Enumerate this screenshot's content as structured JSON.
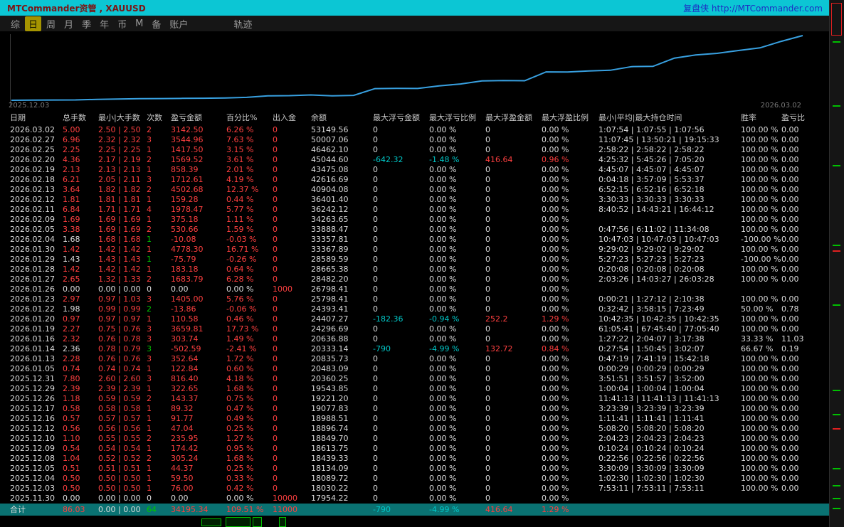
{
  "title_bar": {
    "app_title": "MTCommander资管 , XAUUSD",
    "brand": "复盘侠 http://MTCommander.com"
  },
  "menu": {
    "items": [
      "综",
      "日",
      "周",
      "月",
      "季",
      "年",
      "币",
      "M",
      "备",
      "账户"
    ],
    "selected_index": 1,
    "extra_item": "轨迹"
  },
  "chart": {
    "x_start_label": "2025.12.03",
    "x_end_label": "2026.03.02",
    "line_color": "#38a0e0"
  },
  "chart_data": {
    "type": "line",
    "title": "",
    "xlabel": "",
    "ylabel": "余额",
    "ylim": [
      17900,
      53200
    ],
    "grid": false,
    "legend": false,
    "x": [
      "2025.11.30",
      "2025.12.03",
      "2025.12.04",
      "2025.12.05",
      "2025.12.08",
      "2025.12.09",
      "2025.12.10",
      "2025.12.12",
      "2025.12.16",
      "2025.12.17",
      "2025.12.26",
      "2025.12.29",
      "2025.12.31",
      "2026.01.05",
      "2026.01.13",
      "2026.01.14",
      "2026.01.16",
      "2026.01.19",
      "2026.01.20",
      "2026.01.22",
      "2026.01.23",
      "2026.01.26",
      "2026.01.27",
      "2026.01.28",
      "2026.01.29",
      "2026.01.30",
      "2026.02.04",
      "2026.02.05",
      "2026.02.09",
      "2026.02.11",
      "2026.02.12",
      "2026.02.13",
      "2026.02.18",
      "2026.02.19",
      "2026.02.20",
      "2026.02.25",
      "2026.02.27",
      "2026.03.02"
    ],
    "series": [
      {
        "name": "余额",
        "values": [
          17954.22,
          18030.22,
          18089.72,
          18134.09,
          18439.33,
          18613.75,
          18849.7,
          18896.74,
          18988.51,
          19077.83,
          19221.2,
          19543.85,
          20360.25,
          20483.09,
          20835.73,
          20333.14,
          20636.88,
          24296.69,
          24407.27,
          24393.41,
          25798.41,
          26798.41,
          28482.2,
          28665.38,
          28589.59,
          33367.89,
          33357.81,
          33888.47,
          34263.65,
          36242.12,
          36401.4,
          40904.08,
          42616.69,
          43475.08,
          45044.6,
          46462.1,
          50007.06,
          53149.56
        ]
      }
    ]
  },
  "table": {
    "headers": [
      "日期",
      "总手数",
      "最小|大手数",
      "次数",
      "盈亏金额",
      "百分比%",
      "出入金",
      "余额",
      "最大浮亏金额",
      "最大浮亏比例",
      "最大浮盈金额",
      "最大浮盈比例",
      "最小|平均|最大持仓时间",
      "胜率",
      "盈亏比"
    ],
    "rows": [
      {
        "cells": [
          "2026.03.02",
          "5.00",
          "2.50 | 2.50",
          "2",
          "3142.50",
          "6.26 %",
          "0",
          "53149.56",
          "0",
          "0.00 %",
          "0",
          "0.00 %",
          "1:07:54 | 1:07:55 | 1:07:56",
          "100.00 %",
          "0.00"
        ]
      },
      {
        "cells": [
          "2026.02.27",
          "6.96",
          "2.32 | 2.32",
          "3",
          "3544.96",
          "7.63 %",
          "0",
          "50007.06",
          "0",
          "0.00 %",
          "0",
          "0.00 %",
          "11:07:45 | 13:50:21 | 19:15:33",
          "100.00 %",
          "0.00"
        ]
      },
      {
        "cells": [
          "2026.02.25",
          "2.25",
          "2.25 | 2.25",
          "1",
          "1417.50",
          "3.15 %",
          "0",
          "46462.10",
          "0",
          "0.00 %",
          "0",
          "0.00 %",
          "2:58:22 | 2:58:22 | 2:58:22",
          "100.00 %",
          "0.00"
        ]
      },
      {
        "cells": [
          "2026.02.20",
          "4.36",
          "2.17 | 2.19",
          "2",
          "1569.52",
          "3.61 %",
          "0",
          "45044.60",
          "-642.32",
          "-1.48 %",
          "416.64",
          "0.96 %",
          "4:25:32 | 5:45:26 | 7:05:20",
          "100.00 %",
          "0.00"
        ]
      },
      {
        "cells": [
          "2026.02.19",
          "2.13",
          "2.13 | 2.13",
          "1",
          "858.39",
          "2.01 %",
          "0",
          "43475.08",
          "0",
          "0.00 %",
          "0",
          "0.00 %",
          "4:45:07 | 4:45:07 | 4:45:07",
          "100.00 %",
          "0.00"
        ]
      },
      {
        "cells": [
          "2026.02.18",
          "6.21",
          "2.05 | 2.11",
          "3",
          "1712.61",
          "4.19 %",
          "0",
          "42616.69",
          "0",
          "0.00 %",
          "0",
          "0.00 %",
          "0:04:18 | 3:57:09 | 5:53:37",
          "100.00 %",
          "0.00"
        ]
      },
      {
        "cells": [
          "2026.02.13",
          "3.64",
          "1.82 | 1.82",
          "2",
          "4502.68",
          "12.37 %",
          "0",
          "40904.08",
          "0",
          "0.00 %",
          "0",
          "0.00 %",
          "6:52:15 | 6:52:16 | 6:52:18",
          "100.00 %",
          "0.00"
        ]
      },
      {
        "cells": [
          "2026.02.12",
          "1.81",
          "1.81 | 1.81",
          "1",
          "159.28",
          "0.44 %",
          "0",
          "36401.40",
          "0",
          "0.00 %",
          "0",
          "0.00 %",
          "3:30:33 | 3:30:33 | 3:30:33",
          "100.00 %",
          "0.00"
        ]
      },
      {
        "cells": [
          "2026.02.11",
          "6.84",
          "1.71 | 1.71",
          "4",
          "1978.47",
          "5.77 %",
          "0",
          "36242.12",
          "0",
          "0.00 %",
          "0",
          "0.00 %",
          "8:40:52 | 14:43:21 | 16:44:12",
          "100.00 %",
          "0.00"
        ]
      },
      {
        "cells": [
          "2026.02.09",
          "1.69",
          "1.69 | 1.69",
          "1",
          "375.18",
          "1.11 %",
          "0",
          "34263.65",
          "0",
          "0.00 %",
          "0",
          "0.00 %",
          "",
          "100.00 %",
          "0.00"
        ]
      },
      {
        "cells": [
          "2026.02.05",
          "3.38",
          "1.69 | 1.69",
          "2",
          "530.66",
          "1.59 %",
          "0",
          "33888.47",
          "0",
          "0.00 %",
          "0",
          "0.00 %",
          "0:47:56 | 6:11:02 | 11:34:08",
          "100.00 %",
          "0.00"
        ]
      },
      {
        "cells": [
          "2026.02.04",
          "1.68",
          "1.68 | 1.68",
          "1",
          "-10.08",
          "-0.03 %",
          "0",
          "33357.81",
          "0",
          "0.00 %",
          "0",
          "0.00 %",
          "10:47:03 | 10:47:03 | 10:47:03",
          "-100.00 %",
          "0.00"
        ],
        "loss": true
      },
      {
        "cells": [
          "2026.01.30",
          "1.42",
          "1.42 | 1.42",
          "1",
          "4778.30",
          "16.71 %",
          "0",
          "33367.89",
          "0",
          "0.00 %",
          "0",
          "0.00 %",
          "9:29:02 | 9:29:02 | 9:29:02",
          "100.00 %",
          "0.00"
        ]
      },
      {
        "cells": [
          "2026.01.29",
          "1.43",
          "1.43 | 1.43",
          "1",
          "-75.79",
          "-0.26 %",
          "0",
          "28589.59",
          "0",
          "0.00 %",
          "0",
          "0.00 %",
          "5:27:23 | 5:27:23 | 5:27:23",
          "-100.00 %",
          "0.00"
        ],
        "loss": true
      },
      {
        "cells": [
          "2026.01.28",
          "1.42",
          "1.42 | 1.42",
          "1",
          "183.18",
          "0.64 %",
          "0",
          "28665.38",
          "0",
          "0.00 %",
          "0",
          "0.00 %",
          "0:20:08 | 0:20:08 | 0:20:08",
          "100.00 %",
          "0.00"
        ]
      },
      {
        "cells": [
          "2026.01.27",
          "2.65",
          "1.32 | 1.33",
          "2",
          "1683.79",
          "6.28 %",
          "0",
          "28482.20",
          "0",
          "0.00 %",
          "0",
          "0.00 %",
          "2:03:26 | 14:03:27 | 26:03:28",
          "100.00 %",
          "0.00"
        ]
      },
      {
        "cells": [
          "2026.01.26",
          "0.00",
          "0.00 | 0.00",
          "0",
          "0.00",
          "0.00 %",
          "1000",
          "26798.41",
          "0",
          "0.00 %",
          "0",
          "0.00 %",
          "",
          "",
          ""
        ],
        "flat": true
      },
      {
        "cells": [
          "2026.01.23",
          "2.97",
          "0.97 | 1.03",
          "3",
          "1405.00",
          "5.76 %",
          "0",
          "25798.41",
          "0",
          "0.00 %",
          "0",
          "0.00 %",
          "0:00:21 | 1:27:12 | 2:10:38",
          "100.00 %",
          "0.00"
        ]
      },
      {
        "cells": [
          "2026.01.22",
          "1.98",
          "0.99 | 0.99",
          "2",
          "-13.86",
          "-0.06 %",
          "0",
          "24393.41",
          "0",
          "0.00 %",
          "0",
          "0.00 %",
          "0:32:42 | 3:58:15 | 7:23:49",
          "50.00 %",
          "0.78"
        ],
        "loss": true
      },
      {
        "cells": [
          "2026.01.20",
          "0.97",
          "0.97 | 0.97",
          "1",
          "110.58",
          "0.46 %",
          "0",
          "24407.27",
          "-182.36",
          "-0.94 %",
          "252.2",
          "1.29 %",
          "10:42:35 | 10:42:35 | 10:42:35",
          "100.00 %",
          "0.00"
        ]
      },
      {
        "cells": [
          "2026.01.19",
          "2.27",
          "0.75 | 0.76",
          "3",
          "3659.81",
          "17.73 %",
          "0",
          "24296.69",
          "0",
          "0.00 %",
          "0",
          "0.00 %",
          "61:05:41 | 67:45:40 | 77:05:40",
          "100.00 %",
          "0.00"
        ]
      },
      {
        "cells": [
          "2026.01.16",
          "2.32",
          "0.76 | 0.78",
          "3",
          "303.74",
          "1.49 %",
          "0",
          "20636.88",
          "0",
          "0.00 %",
          "0",
          "0.00 %",
          "1:27:22 | 2:04:07 | 3:17:38",
          "33.33 %",
          "11.03"
        ]
      },
      {
        "cells": [
          "2026.01.14",
          "2.36",
          "0.78 | 0.79",
          "3",
          "-502.59",
          "-2.41 %",
          "0",
          "20333.14",
          "-790",
          "-4.99 %",
          "132.72",
          "0.84 %",
          "0:27:54 | 1:50:45 | 3:02:07",
          "66.67 %",
          "0.19"
        ],
        "loss": true
      },
      {
        "cells": [
          "2026.01.13",
          "2.28",
          "0.76 | 0.76",
          "3",
          "352.64",
          "1.72 %",
          "0",
          "20835.73",
          "0",
          "0.00 %",
          "0",
          "0.00 %",
          "0:47:19 | 7:41:19 | 15:42:18",
          "100.00 %",
          "0.00"
        ]
      },
      {
        "cells": [
          "2026.01.05",
          "0.74",
          "0.74 | 0.74",
          "1",
          "122.84",
          "0.60 %",
          "0",
          "20483.09",
          "0",
          "0.00 %",
          "0",
          "0.00 %",
          "0:00:29 | 0:00:29 | 0:00:29",
          "100.00 %",
          "0.00"
        ]
      },
      {
        "cells": [
          "2025.12.31",
          "7.80",
          "2.60 | 2.60",
          "3",
          "816.40",
          "4.18 %",
          "0",
          "20360.25",
          "0",
          "0.00 %",
          "0",
          "0.00 %",
          "3:51:51 | 3:51:57 | 3:52:00",
          "100.00 %",
          "0.00"
        ]
      },
      {
        "cells": [
          "2025.12.29",
          "2.39",
          "2.39 | 2.39",
          "1",
          "322.65",
          "1.68 %",
          "0",
          "19543.85",
          "0",
          "0.00 %",
          "0",
          "0.00 %",
          "1:00:04 | 1:00:04 | 1:00:04",
          "100.00 %",
          "0.00"
        ]
      },
      {
        "cells": [
          "2025.12.26",
          "1.18",
          "0.59 | 0.59",
          "2",
          "143.37",
          "0.75 %",
          "0",
          "19221.20",
          "0",
          "0.00 %",
          "0",
          "0.00 %",
          "11:41:13 | 11:41:13 | 11:41:13",
          "100.00 %",
          "0.00"
        ]
      },
      {
        "cells": [
          "2025.12.17",
          "0.58",
          "0.58 | 0.58",
          "1",
          "89.32",
          "0.47 %",
          "0",
          "19077.83",
          "0",
          "0.00 %",
          "0",
          "0.00 %",
          "3:23:39 | 3:23:39 | 3:23:39",
          "100.00 %",
          "0.00"
        ]
      },
      {
        "cells": [
          "2025.12.16",
          "0.57",
          "0.57 | 0.57",
          "1",
          "91.77",
          "0.49 %",
          "0",
          "18988.51",
          "0",
          "0.00 %",
          "0",
          "0.00 %",
          "1:11:41 | 1:11:41 | 1:11:41",
          "100.00 %",
          "0.00"
        ]
      },
      {
        "cells": [
          "2025.12.12",
          "0.56",
          "0.56 | 0.56",
          "1",
          "47.04",
          "0.25 %",
          "0",
          "18896.74",
          "0",
          "0.00 %",
          "0",
          "0.00 %",
          "5:08:20 | 5:08:20 | 5:08:20",
          "100.00 %",
          "0.00"
        ]
      },
      {
        "cells": [
          "2025.12.10",
          "1.10",
          "0.55 | 0.55",
          "2",
          "235.95",
          "1.27 %",
          "0",
          "18849.70",
          "0",
          "0.00 %",
          "0",
          "0.00 %",
          "2:04:23 | 2:04:23 | 2:04:23",
          "100.00 %",
          "0.00"
        ]
      },
      {
        "cells": [
          "2025.12.09",
          "0.54",
          "0.54 | 0.54",
          "1",
          "174.42",
          "0.95 %",
          "0",
          "18613.75",
          "0",
          "0.00 %",
          "0",
          "0.00 %",
          "0:10:24 | 0:10:24 | 0:10:24",
          "100.00 %",
          "0.00"
        ]
      },
      {
        "cells": [
          "2025.12.08",
          "1.04",
          "0.52 | 0.52",
          "2",
          "305.24",
          "1.68 %",
          "0",
          "18439.33",
          "0",
          "0.00 %",
          "0",
          "0.00 %",
          "0:22:56 | 0:22:56 | 0:22:56",
          "100.00 %",
          "0.00"
        ]
      },
      {
        "cells": [
          "2025.12.05",
          "0.51",
          "0.51 | 0.51",
          "1",
          "44.37",
          "0.25 %",
          "0",
          "18134.09",
          "0",
          "0.00 %",
          "0",
          "0.00 %",
          "3:30:09 | 3:30:09 | 3:30:09",
          "100.00 %",
          "0.00"
        ]
      },
      {
        "cells": [
          "2025.12.04",
          "0.50",
          "0.50 | 0.50",
          "1",
          "59.50",
          "0.33 %",
          "0",
          "18089.72",
          "0",
          "0.00 %",
          "0",
          "0.00 %",
          "1:02:30 | 1:02:30 | 1:02:30",
          "100.00 %",
          "0.00"
        ]
      },
      {
        "cells": [
          "2025.12.03",
          "0.50",
          "0.50 | 0.50",
          "1",
          "76.00",
          "0.42 %",
          "0",
          "18030.22",
          "0",
          "0.00 %",
          "0",
          "0.00 %",
          "7:53:11 | 7:53:11 | 7:53:11",
          "100.00 %",
          "0.00"
        ]
      },
      {
        "cells": [
          "2025.11.30",
          "0.00",
          "0.00 | 0.00",
          "0",
          "0.00",
          "0.00 %",
          "10000",
          "17954.22",
          "0",
          "0.00 %",
          "0",
          "0.00 %",
          "",
          "",
          ""
        ],
        "flat": true
      }
    ],
    "total_row": {
      "cells": [
        "合计",
        "86.03",
        "0.00 | 0.00",
        "64",
        "34195.34",
        "109.51 %",
        "11000",
        "",
        "-790",
        "-4.99 %",
        "416.64",
        "1.29 %",
        "",
        "",
        ""
      ],
      "total": true
    }
  }
}
